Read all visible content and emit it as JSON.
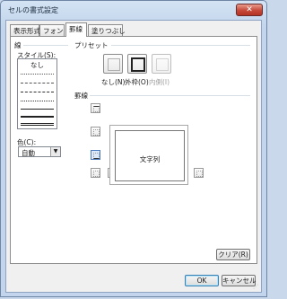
{
  "window": {
    "title": "セルの書式設定",
    "close_label": "✕"
  },
  "tabs": [
    {
      "label": "表示形式",
      "active": false
    },
    {
      "label": "フォント",
      "active": false
    },
    {
      "label": "罫線",
      "active": true
    },
    {
      "label": "塗りつぶし",
      "active": false
    }
  ],
  "line_group": {
    "label": "線",
    "style_label": "スタイル(S):",
    "style_none": "なし",
    "color_label": "色(C):",
    "color_value": "自動"
  },
  "preset_group": {
    "label": "プリセット",
    "buttons": [
      {
        "label": "なし(N)",
        "enabled": true
      },
      {
        "label": "外枠(O)",
        "enabled": true
      },
      {
        "label": "内側(I)",
        "enabled": false
      }
    ]
  },
  "border_group": {
    "label": "罫線",
    "preview_text": "文字列"
  },
  "buttons": {
    "clear": "クリア(R)",
    "ok": "OK",
    "cancel": "キャンセル"
  }
}
